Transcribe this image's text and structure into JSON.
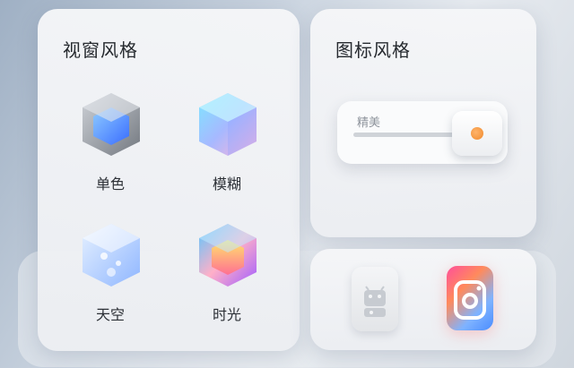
{
  "window_style": {
    "title": "视窗风格",
    "options": [
      {
        "label": "单色",
        "icon": "monochrome-cube-icon"
      },
      {
        "label": "模糊",
        "icon": "blur-cube-icon"
      },
      {
        "label": "天空",
        "icon": "sky-cube-icon"
      },
      {
        "label": "时光",
        "icon": "time-cube-icon"
      }
    ]
  },
  "icon_style": {
    "title": "图标风格",
    "slider_label": "精美",
    "accent": "#f39236"
  },
  "apps": [
    {
      "icon": "android-icon"
    },
    {
      "icon": "camera-icon"
    }
  ]
}
